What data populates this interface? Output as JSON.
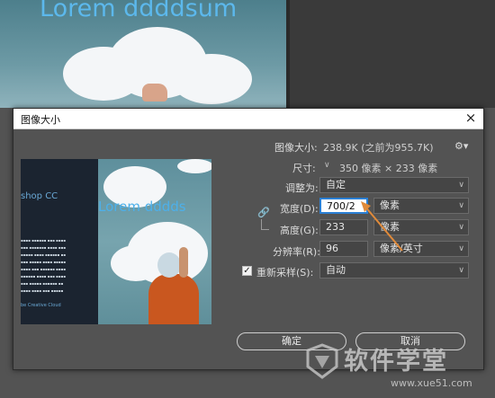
{
  "background": {
    "doc_title": "Lorem ddddsum"
  },
  "dialog": {
    "title": "图像大小",
    "close_label": "×",
    "image_size_label": "图像大小:",
    "image_size_value": "238.9K (之前为955.7K)",
    "dimensions_label": "尺寸:",
    "dimensions_value": "350 像素 × 233 像素",
    "fit_to_label": "调整为:",
    "fit_to_value": "自定",
    "width_label": "宽度(D):",
    "width_value": "700/2",
    "width_unit": "像素",
    "height_label": "高度(G):",
    "height_value": "233",
    "height_unit": "像素",
    "resolution_label": "分辨率(R):",
    "resolution_value": "96",
    "resolution_unit": "像素/英寸",
    "resample_label": "重新采样(S):",
    "resample_value": "自动",
    "ok_label": "确定",
    "cancel_label": "取消"
  },
  "preview": {
    "title_text": "Lorem dddds",
    "left_panel_text": "shop CC",
    "footer_text": "be Creative Cloud"
  },
  "watermark": {
    "text": "软件学堂",
    "url": "www.xue51.com"
  },
  "colors": {
    "accent_focus": "#2a7fd4",
    "arrow": "#e08a3a",
    "dialog_bg": "#535353"
  }
}
